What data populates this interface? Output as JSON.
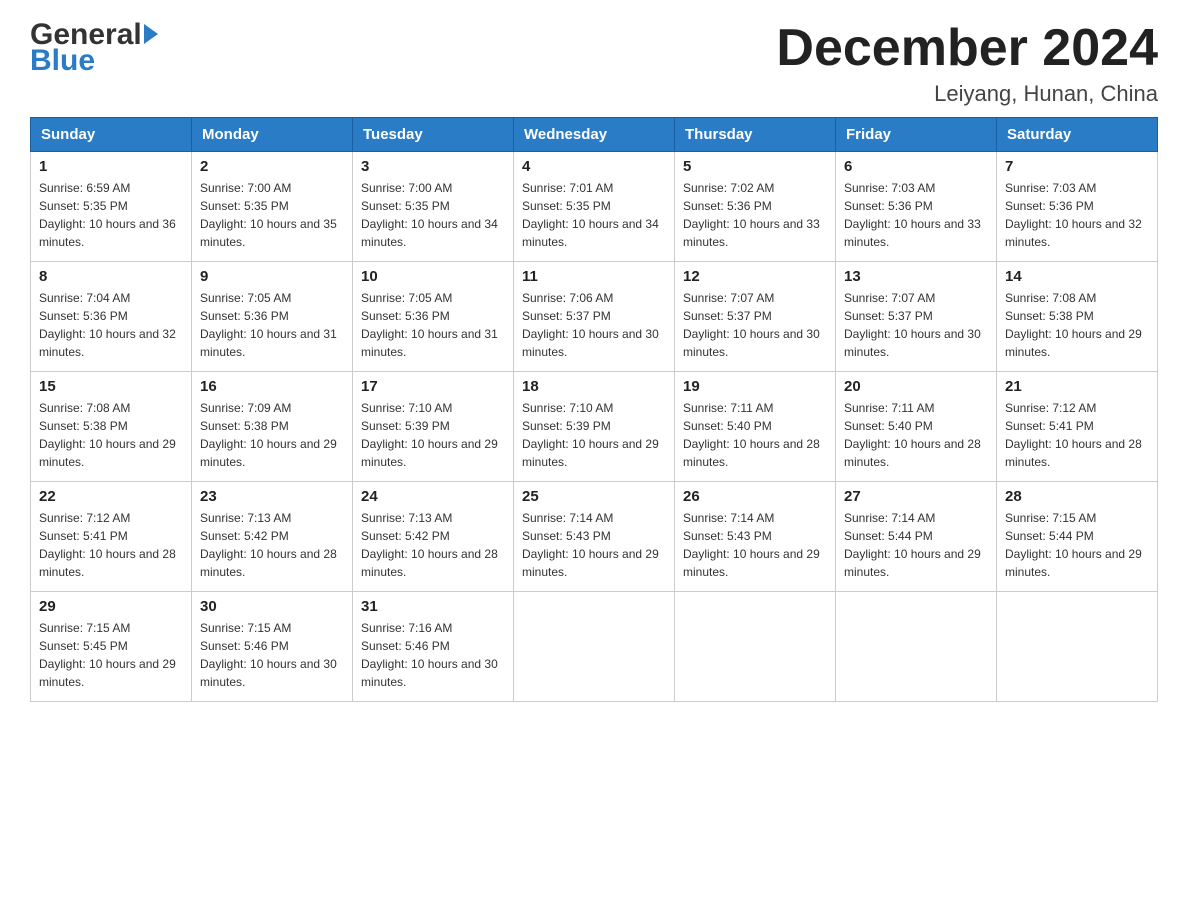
{
  "logo": {
    "general": "General",
    "blue": "Blue",
    "arrow_alt": "arrow"
  },
  "title": "December 2024",
  "subtitle": "Leiyang, Hunan, China",
  "weekdays": [
    "Sunday",
    "Monday",
    "Tuesday",
    "Wednesday",
    "Thursday",
    "Friday",
    "Saturday"
  ],
  "weeks": [
    [
      {
        "day": "1",
        "sunrise": "Sunrise: 6:59 AM",
        "sunset": "Sunset: 5:35 PM",
        "daylight": "Daylight: 10 hours and 36 minutes."
      },
      {
        "day": "2",
        "sunrise": "Sunrise: 7:00 AM",
        "sunset": "Sunset: 5:35 PM",
        "daylight": "Daylight: 10 hours and 35 minutes."
      },
      {
        "day": "3",
        "sunrise": "Sunrise: 7:00 AM",
        "sunset": "Sunset: 5:35 PM",
        "daylight": "Daylight: 10 hours and 34 minutes."
      },
      {
        "day": "4",
        "sunrise": "Sunrise: 7:01 AM",
        "sunset": "Sunset: 5:35 PM",
        "daylight": "Daylight: 10 hours and 34 minutes."
      },
      {
        "day": "5",
        "sunrise": "Sunrise: 7:02 AM",
        "sunset": "Sunset: 5:36 PM",
        "daylight": "Daylight: 10 hours and 33 minutes."
      },
      {
        "day": "6",
        "sunrise": "Sunrise: 7:03 AM",
        "sunset": "Sunset: 5:36 PM",
        "daylight": "Daylight: 10 hours and 33 minutes."
      },
      {
        "day": "7",
        "sunrise": "Sunrise: 7:03 AM",
        "sunset": "Sunset: 5:36 PM",
        "daylight": "Daylight: 10 hours and 32 minutes."
      }
    ],
    [
      {
        "day": "8",
        "sunrise": "Sunrise: 7:04 AM",
        "sunset": "Sunset: 5:36 PM",
        "daylight": "Daylight: 10 hours and 32 minutes."
      },
      {
        "day": "9",
        "sunrise": "Sunrise: 7:05 AM",
        "sunset": "Sunset: 5:36 PM",
        "daylight": "Daylight: 10 hours and 31 minutes."
      },
      {
        "day": "10",
        "sunrise": "Sunrise: 7:05 AM",
        "sunset": "Sunset: 5:36 PM",
        "daylight": "Daylight: 10 hours and 31 minutes."
      },
      {
        "day": "11",
        "sunrise": "Sunrise: 7:06 AM",
        "sunset": "Sunset: 5:37 PM",
        "daylight": "Daylight: 10 hours and 30 minutes."
      },
      {
        "day": "12",
        "sunrise": "Sunrise: 7:07 AM",
        "sunset": "Sunset: 5:37 PM",
        "daylight": "Daylight: 10 hours and 30 minutes."
      },
      {
        "day": "13",
        "sunrise": "Sunrise: 7:07 AM",
        "sunset": "Sunset: 5:37 PM",
        "daylight": "Daylight: 10 hours and 30 minutes."
      },
      {
        "day": "14",
        "sunrise": "Sunrise: 7:08 AM",
        "sunset": "Sunset: 5:38 PM",
        "daylight": "Daylight: 10 hours and 29 minutes."
      }
    ],
    [
      {
        "day": "15",
        "sunrise": "Sunrise: 7:08 AM",
        "sunset": "Sunset: 5:38 PM",
        "daylight": "Daylight: 10 hours and 29 minutes."
      },
      {
        "day": "16",
        "sunrise": "Sunrise: 7:09 AM",
        "sunset": "Sunset: 5:38 PM",
        "daylight": "Daylight: 10 hours and 29 minutes."
      },
      {
        "day": "17",
        "sunrise": "Sunrise: 7:10 AM",
        "sunset": "Sunset: 5:39 PM",
        "daylight": "Daylight: 10 hours and 29 minutes."
      },
      {
        "day": "18",
        "sunrise": "Sunrise: 7:10 AM",
        "sunset": "Sunset: 5:39 PM",
        "daylight": "Daylight: 10 hours and 29 minutes."
      },
      {
        "day": "19",
        "sunrise": "Sunrise: 7:11 AM",
        "sunset": "Sunset: 5:40 PM",
        "daylight": "Daylight: 10 hours and 28 minutes."
      },
      {
        "day": "20",
        "sunrise": "Sunrise: 7:11 AM",
        "sunset": "Sunset: 5:40 PM",
        "daylight": "Daylight: 10 hours and 28 minutes."
      },
      {
        "day": "21",
        "sunrise": "Sunrise: 7:12 AM",
        "sunset": "Sunset: 5:41 PM",
        "daylight": "Daylight: 10 hours and 28 minutes."
      }
    ],
    [
      {
        "day": "22",
        "sunrise": "Sunrise: 7:12 AM",
        "sunset": "Sunset: 5:41 PM",
        "daylight": "Daylight: 10 hours and 28 minutes."
      },
      {
        "day": "23",
        "sunrise": "Sunrise: 7:13 AM",
        "sunset": "Sunset: 5:42 PM",
        "daylight": "Daylight: 10 hours and 28 minutes."
      },
      {
        "day": "24",
        "sunrise": "Sunrise: 7:13 AM",
        "sunset": "Sunset: 5:42 PM",
        "daylight": "Daylight: 10 hours and 28 minutes."
      },
      {
        "day": "25",
        "sunrise": "Sunrise: 7:14 AM",
        "sunset": "Sunset: 5:43 PM",
        "daylight": "Daylight: 10 hours and 29 minutes."
      },
      {
        "day": "26",
        "sunrise": "Sunrise: 7:14 AM",
        "sunset": "Sunset: 5:43 PM",
        "daylight": "Daylight: 10 hours and 29 minutes."
      },
      {
        "day": "27",
        "sunrise": "Sunrise: 7:14 AM",
        "sunset": "Sunset: 5:44 PM",
        "daylight": "Daylight: 10 hours and 29 minutes."
      },
      {
        "day": "28",
        "sunrise": "Sunrise: 7:15 AM",
        "sunset": "Sunset: 5:44 PM",
        "daylight": "Daylight: 10 hours and 29 minutes."
      }
    ],
    [
      {
        "day": "29",
        "sunrise": "Sunrise: 7:15 AM",
        "sunset": "Sunset: 5:45 PM",
        "daylight": "Daylight: 10 hours and 29 minutes."
      },
      {
        "day": "30",
        "sunrise": "Sunrise: 7:15 AM",
        "sunset": "Sunset: 5:46 PM",
        "daylight": "Daylight: 10 hours and 30 minutes."
      },
      {
        "day": "31",
        "sunrise": "Sunrise: 7:16 AM",
        "sunset": "Sunset: 5:46 PM",
        "daylight": "Daylight: 10 hours and 30 minutes."
      },
      null,
      null,
      null,
      null
    ]
  ]
}
